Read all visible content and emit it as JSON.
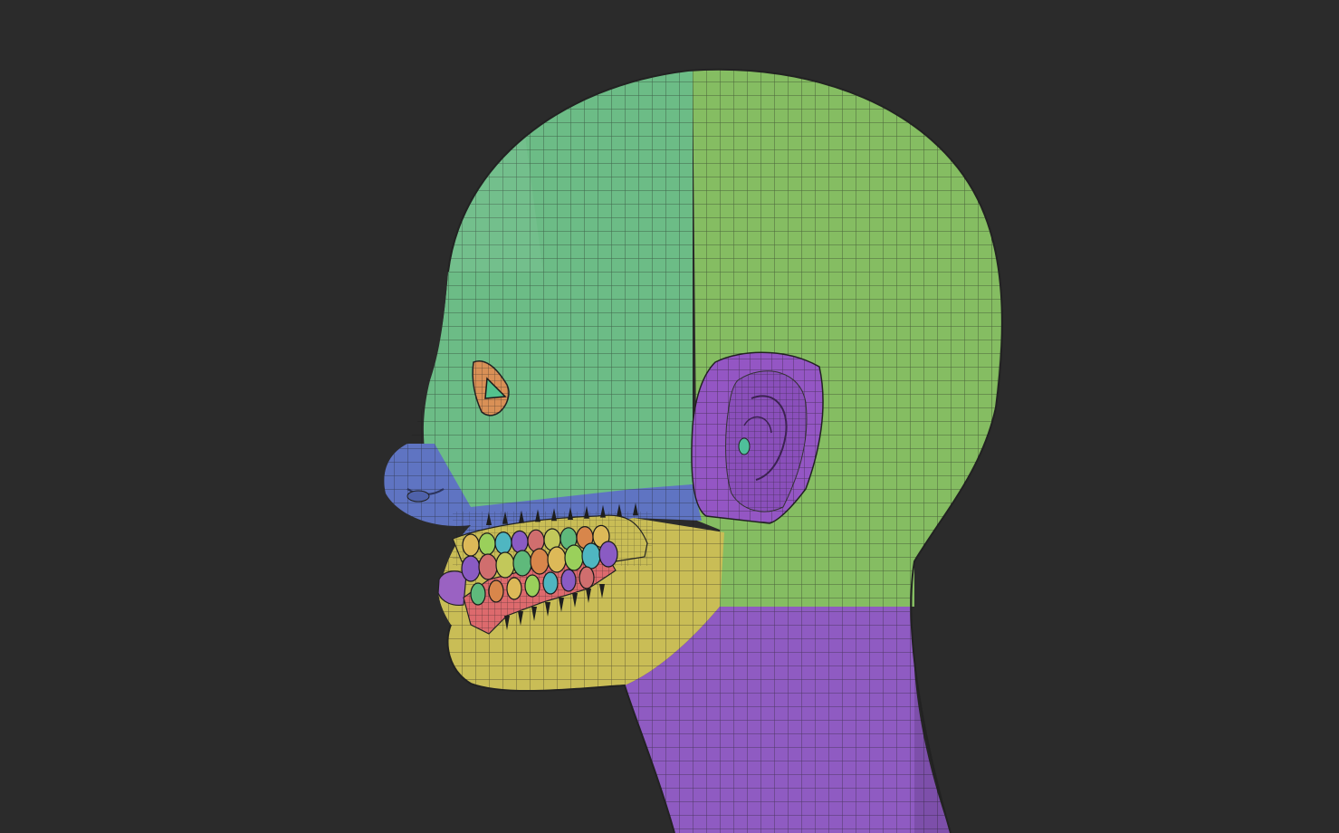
{
  "scene": {
    "background": "#2b2b2b",
    "wire_color": "#1c1c1c",
    "polygroups": {
      "face": "#6cbc86",
      "cranium": "#85bd62",
      "ear": "#9456c4",
      "neck": "#8f5bc2",
      "jaw": "#c9bd56",
      "muzzle": "#5f74c2",
      "eye_socket": "#d99056",
      "eyeball": "#53c28d",
      "gum": "#dd6a6d",
      "ear_canal": "#4fbf9a"
    },
    "tooth_colors": [
      "#ddb958",
      "#9ad05b",
      "#4fb6c1",
      "#8a5bc3",
      "#d06e6e",
      "#c2c85a",
      "#5fb97b",
      "#d8864b"
    ]
  }
}
